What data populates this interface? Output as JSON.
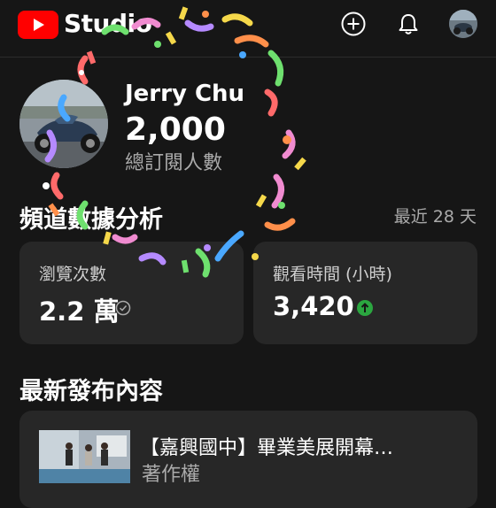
{
  "header": {
    "studio_label": "Studio",
    "icons": [
      "youtube-logo",
      "create-plus-icon",
      "bell-icon",
      "account-avatar"
    ]
  },
  "channel": {
    "name": "Jerry Chu",
    "subscribers": "2,000",
    "subscribers_label": "總訂閱人數"
  },
  "analytics": {
    "title": "頻道數據分析",
    "period": "最近 28 天",
    "views": {
      "label": "瀏覽次數",
      "value": "2.2 萬",
      "status_icon": "check-circle-icon"
    },
    "watch_time": {
      "label": "觀看時間 (小時)",
      "value": "3,420",
      "status_icon": "arrow-up-green-icon"
    }
  },
  "latest": {
    "title": "最新發布內容",
    "video_title": "【嘉興國中】畢業美展開幕…",
    "video_subtitle": "著作權"
  },
  "colors": {
    "background": "#161616",
    "card": "#272727",
    "brand_red": "#ff0000",
    "success_green": "#2ba640"
  }
}
